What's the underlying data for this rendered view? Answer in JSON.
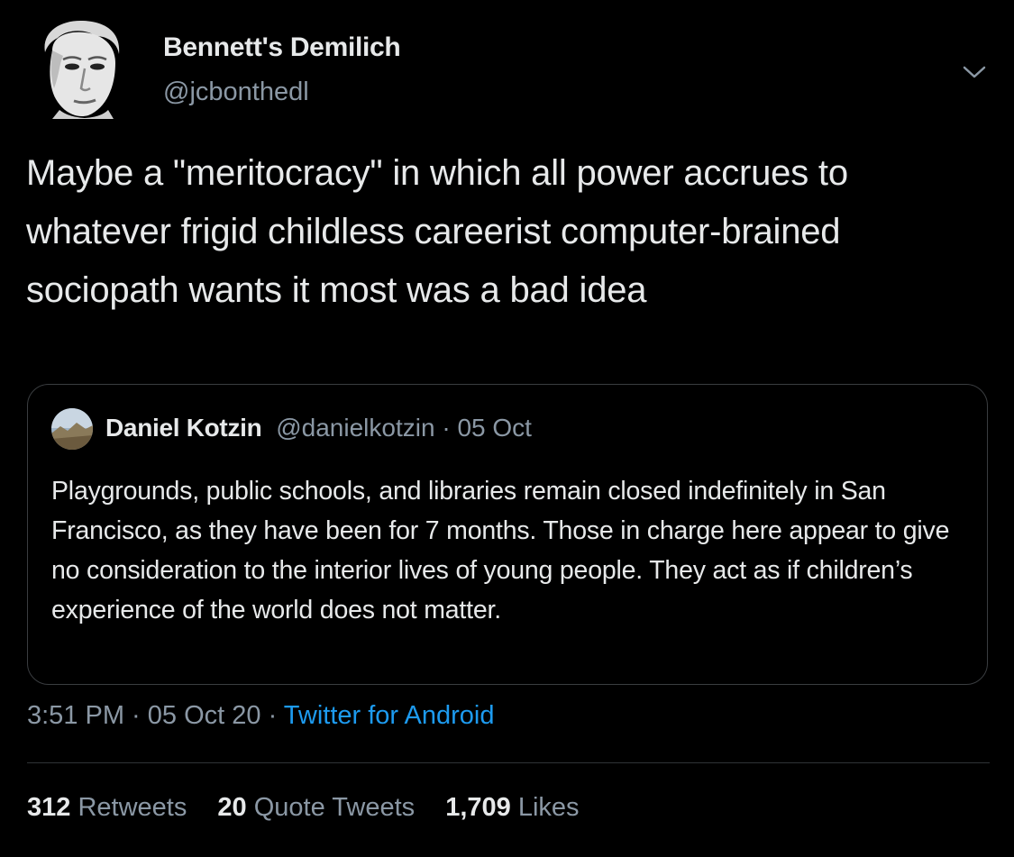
{
  "tweet": {
    "author": {
      "name": "Bennett's Demilich",
      "handle": "@jcbonthedl",
      "avatar_icon": "portrait-avatar"
    },
    "text": "Maybe a \"meritocracy\" in which all power accrues to whatever frigid childless careerist computer-brained sociopath wants it most was a bad idea",
    "menu_icon": "chevron-down-icon",
    "quoted": {
      "name": "Daniel Kotzin",
      "handle": "@danielkotzin",
      "separator": " · ",
      "date": "05 Oct",
      "text": "Playgrounds, public schools, and libraries remain closed indefinitely in San Francisco, as they have been for 7 months. Those in charge here appear to give no consideration to the interior lives of young people. They act as if children’s experience of the world does not matter.",
      "avatar_icon": "landscape-avatar"
    },
    "time": "3:51 PM",
    "sep1": " · ",
    "date": "05 Oct 20",
    "sep2": " · ",
    "source": "Twitter for Android",
    "stats": {
      "retweets_count": "312",
      "retweets_label": "Retweets",
      "quotes_count": "20",
      "quotes_label": "Quote Tweets",
      "likes_count": "1,709",
      "likes_label": "Likes"
    }
  },
  "colors": {
    "background": "#000000",
    "primary_text": "#e7e9ea",
    "secondary_text": "#8b98a5",
    "link": "#1d9bf0",
    "border": "#3a3d40"
  }
}
